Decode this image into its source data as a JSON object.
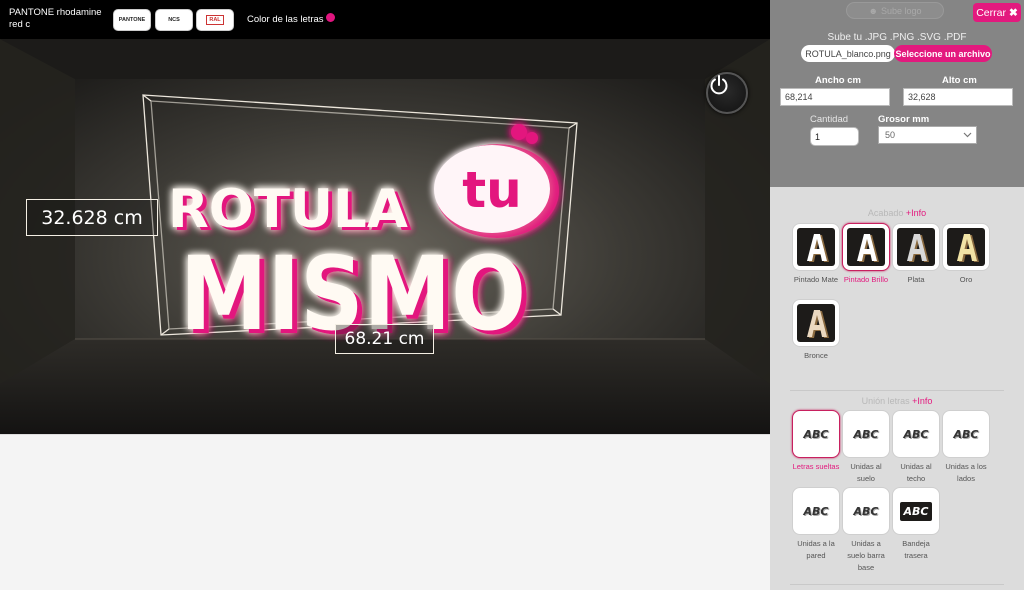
{
  "topbar": {
    "pantone_label": "PANTONE rhodamine red c",
    "swatch_buttons": [
      "PANTONE",
      "NCS",
      "RAL"
    ],
    "color_label": "Color de las letras",
    "letter_color": "#e0157f"
  },
  "scene": {
    "height_label": "32.628 cm",
    "width_label": "68.21 cm",
    "sign_line1": "ROTULA",
    "sign_line2": "MISMO",
    "sign_badge": "tu",
    "power_icon": "power-icon"
  },
  "panel": {
    "sube_logo": "Sube logo",
    "close": "Cerrar",
    "upload_title": "Sube tu .JPG .PNG .SVG .PDF",
    "file_name": "ROTULA_blanco.png",
    "file_button": "Seleccione un archivo",
    "ancho_label": "Ancho cm",
    "ancho_value": "68,214",
    "alto_label": "Alto cm",
    "alto_value": "32,628",
    "cantidad_label": "Cantidad",
    "cantidad_value": "1",
    "grosor_label": "Grosor mm",
    "grosor_value": "50"
  },
  "acabado": {
    "title": "Acabado",
    "info": "+Info",
    "options": [
      {
        "label": "Pintado Mate",
        "color": "#ffffff"
      },
      {
        "label": "Pintado Brillo",
        "color": "#ffffff"
      },
      {
        "label": "Plata",
        "color": "#d8d8d8"
      },
      {
        "label": "Oro",
        "color": "#f1e3a6"
      },
      {
        "label": "Bronce",
        "color": "#ead8c0"
      }
    ],
    "selected": 1
  },
  "union": {
    "title": "Unión letras",
    "info": "+Info",
    "options": [
      {
        "label": "Letras sueltas",
        "glyph": "ABC"
      },
      {
        "label": "Unidas al suelo",
        "glyph": "ABC"
      },
      {
        "label": "Unidas al techo",
        "glyph": "ABC"
      },
      {
        "label": "Unidas a los lados",
        "glyph": "ABC"
      },
      {
        "label": "Unidas a la pared",
        "glyph": "ABC"
      },
      {
        "label": "Unidas a suelo barra base",
        "glyph": "ABC"
      },
      {
        "label": "Bandeja trasera",
        "glyph": "ABC"
      }
    ],
    "selected": 0
  }
}
